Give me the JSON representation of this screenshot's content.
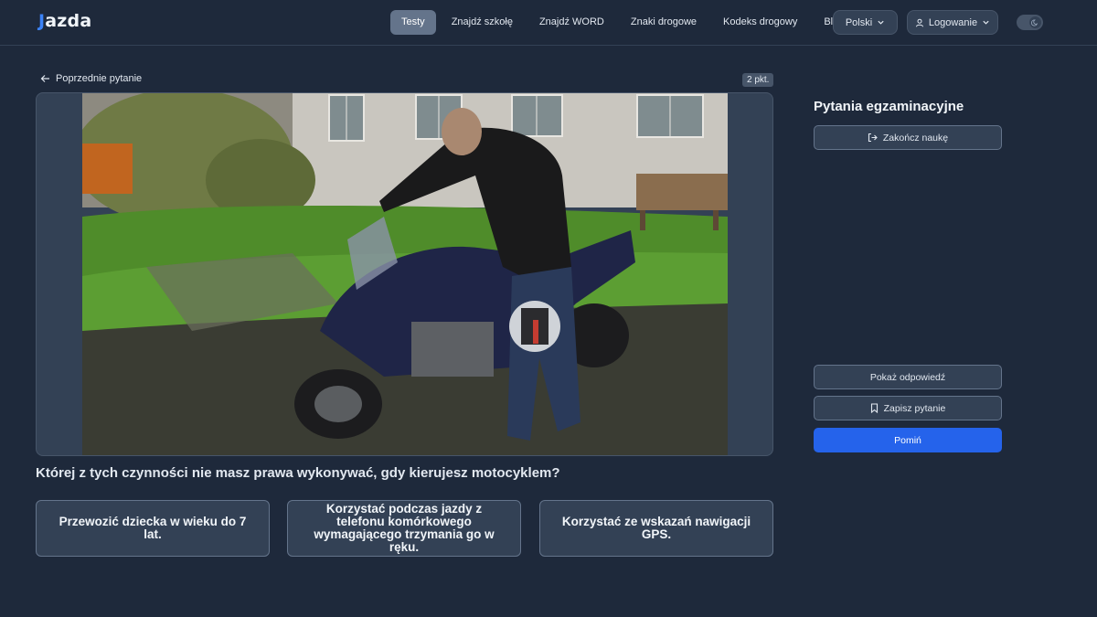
{
  "brand": {
    "logo_mark": "J",
    "logo_text": "azda"
  },
  "nav": {
    "links": [
      "Testy",
      "Znajdź szkołę",
      "Znajdź WORD",
      "Znaki drogowe",
      "Kodeks drogowy",
      "Blog"
    ],
    "active_index": 0,
    "language_label": "Polski",
    "login_label": "Logowanie"
  },
  "question": {
    "back_label": "Poprzednie pytanie",
    "points": "2 pkt.",
    "text": "Której z tych czynności nie masz prawa wykonywać, gdy kierujesz motocyklem?",
    "answers": [
      "Przewozić dziecka w wieku do 7 lat.",
      "Korzystać podczas jazdy z telefonu komórkowego wymagającego trzymania go w ręku.",
      "Korzystać ze wskazań nawigacji GPS."
    ]
  },
  "sidebar": {
    "title": "Pytania egzaminacyjne",
    "finish_label": "Zakończ naukę",
    "show_answer_label": "Pokaż odpowiedź",
    "save_label": "Zapisz pytanie",
    "skip_label": "Pomiń"
  },
  "colors": {
    "accent": "#2563eb",
    "background": "#1e293b",
    "card": "#334155"
  },
  "icons": {
    "back": "arrow-left-icon",
    "language": "chevron-down-icon",
    "login": "user-icon",
    "theme": "moon-icon",
    "finish": "logout-icon",
    "save": "bookmark-icon"
  }
}
